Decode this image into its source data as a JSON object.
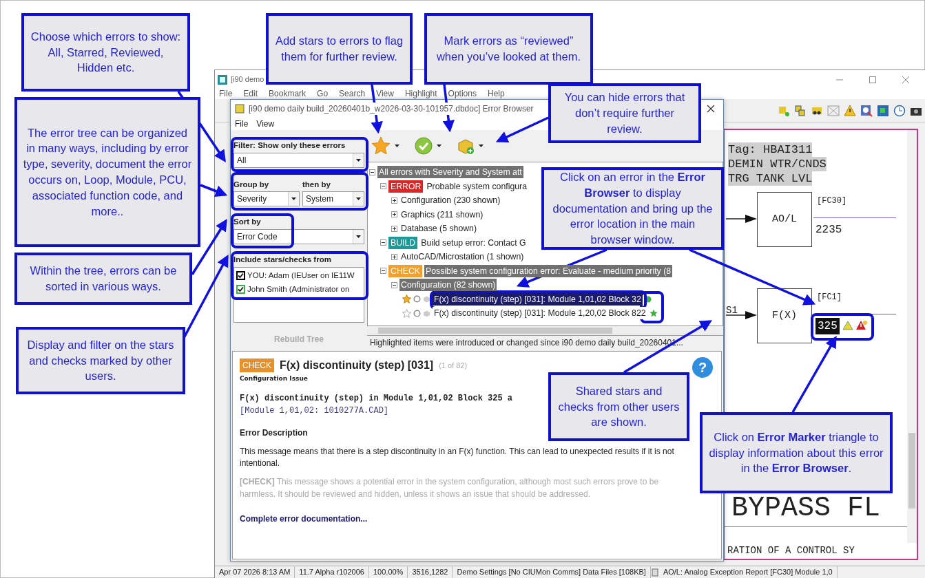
{
  "main_window": {
    "title": "[i90 demo",
    "menu": [
      "File",
      "Edit",
      "Bookmark",
      "Go",
      "Search",
      "View",
      "Highlight",
      "Options",
      "Help"
    ],
    "canvas": {
      "tag_lines": [
        "Tag: HBAI311",
        "DEMIN WTR/CNDS",
        "TRG TANK LVL"
      ],
      "blocks": [
        {
          "label": "AO/L",
          "spec": "[FC30]",
          "output": "2235"
        },
        {
          "label": "F(X)",
          "spec": "[FC1]",
          "input": "S1",
          "output": "325"
        }
      ],
      "big_text": "BYPASS FL",
      "bottom_text": "RATION OF A CONTROL SY"
    },
    "status_bar": [
      "Apr 07 2026 8:13 AM",
      "11.7 Alpha r102006",
      "100.00%",
      "3516,1282",
      "Demo Settings [No CIUMon Comms] Data Files [108KB]",
      "AO/L: Analog Exception Report [FC30] Module 1,0"
    ]
  },
  "error_browser": {
    "title": "[i90 demo daily build_20260401b_w2026-03-30-101957.dbdoc] Error Browser",
    "menu": [
      "File",
      "View"
    ],
    "filter": {
      "label": "Filter: Show only these errors",
      "value": "All"
    },
    "group_by": {
      "label": "Group by",
      "value": "Severity"
    },
    "then_by": {
      "label": "then by",
      "value": "System"
    },
    "sort_by": {
      "label": "Sort by",
      "value": "Error Code"
    },
    "include": {
      "label": "Include stars/checks from",
      "users": [
        {
          "name": "YOU: Adam  (IEUser on IE11W",
          "checked": true,
          "color": "#000000"
        },
        {
          "name": "John Smith (Administrator on",
          "checked": true,
          "color": "#3cb043"
        }
      ]
    },
    "rebuild_button": {
      "label": "Rebuild Tree",
      "disabled": true
    },
    "tree": [
      {
        "kind": "group",
        "label": "All errors with Severity and System att",
        "highlighted": true,
        "expanded": true,
        "selected": false,
        "children": [
          {
            "kind": "group",
            "badge": "ERROR",
            "color": "#e02424",
            "label": "Probable system configura",
            "highlighted": false,
            "expanded": true,
            "selected": false,
            "children": [
              {
                "kind": "group",
                "label": "Configuration (230 shown)",
                "highlighted": false,
                "expanded": false,
                "selected": false
              },
              {
                "kind": "group",
                "label": "Graphics (211 shown)",
                "highlighted": false,
                "expanded": false,
                "selected": false
              },
              {
                "kind": "group",
                "label": "Database (5 shown)",
                "highlighted": false,
                "expanded": false,
                "selected": false
              }
            ]
          },
          {
            "kind": "group",
            "badge": "BUILD",
            "color": "#1a9a9a",
            "label": "Build setup error: Contact G",
            "highlighted": false,
            "expanded": true,
            "selected": false,
            "children": [
              {
                "kind": "group",
                "label": "AutoCAD/Microstation (1 shown)",
                "highlighted": false,
                "expanded": false,
                "selected": false
              }
            ]
          },
          {
            "kind": "group",
            "badge": "CHECK",
            "color": "#f0a030",
            "label": "Possible system configuration error: Evaluate - medium priority (8",
            "highlighted": true,
            "expanded": true,
            "selected": false,
            "children": [
              {
                "kind": "group",
                "label": "Configuration (82 shown)",
                "highlighted": true,
                "expanded": true,
                "selected": false,
                "children": [
                  {
                    "kind": "error",
                    "label": "F(x) discontinuity (step) [031]: Module 1,01,02 Block 32",
                    "starred": true,
                    "selected": true,
                    "shared_checked": true,
                    "shared_starred": false
                  },
                  {
                    "kind": "error",
                    "label": "F(x) discontinuity (step) [031]: Module 1,20,02 Block 822",
                    "starred": false,
                    "selected": false,
                    "shared_checked": false,
                    "shared_starred": true
                  }
                ]
              }
            ]
          }
        ]
      }
    ],
    "tree_status": "Highlighted items were introduced or changed since i90 demo daily build_20260401...",
    "detail": {
      "badge": "CHECK",
      "color": "#e8912a",
      "title": "F(x) discontinuity (step) [031]",
      "count": "(1 of 82)",
      "subtitle": "Configuration Issue",
      "help_icon": "?",
      "location": "F(x) discontinuity (step) in **Module 1,01,02 Block 325** a",
      "file": "[Module 1,01,02: 1010277A.CAD]",
      "heading": "Error Description",
      "description": "This message means that there is a step discontinuity in an F(x) function. This can lead to unexpected results if it is not intentional.",
      "note": "**[CHECK]** This message shows a potential error in the system configuration, although most such errors prove to be harmless. It should be reviewed and hidden, unless it shows an issue that should be addressed.",
      "link": "Complete error documentation..."
    }
  },
  "callouts": [
    {
      "text": "Choose which errors to show: All, Starred, Reviewed, Hidden etc."
    },
    {
      "text": "The error tree can be organized in many ways, including by error type, severity, document the error occurs on, Loop, Module, PCU, associated function code, and more.."
    },
    {
      "text": "Within the tree, errors can be sorted in various ways."
    },
    {
      "text": "Display and filter on the stars and checks marked by other users."
    },
    {
      "text": "Add stars to errors to flag them for further review."
    },
    {
      "text": "Mark errors as “reviewed” when you’ve looked at them."
    },
    {
      "text": "You can hide errors that don’t require further review."
    },
    {
      "text": "Click on an error in the **Error Browser** to display documentation and bring up the error location in the main browser window."
    },
    {
      "text": "Shared stars and checks from other users are shown."
    },
    {
      "text": "Click on **Error Marker** triangle to display information about this error in the **Error Browser**."
    }
  ]
}
